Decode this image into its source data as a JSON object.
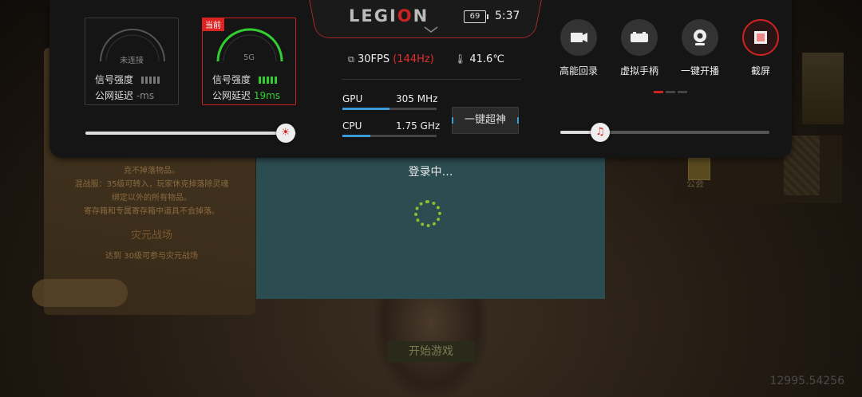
{
  "game": {
    "scroll_lines": [
      {
        "text": "克不掉落物品。",
        "highlight": false
      },
      {
        "text": "混战服：35级可转入，玩家休克掉落除灵魂",
        "highlight": false
      },
      {
        "text": "绑定以外的所有物品。",
        "highlight": false
      },
      {
        "text": "寄存箱和专属寄存箱中道具不会掉落。",
        "highlight": false
      }
    ],
    "scroll_title": "灾元战场",
    "scroll_footer": "达到 30级可参与灾元战场",
    "union_label": "公会",
    "start_button": "开始游戏",
    "coordinates": "12995.54256"
  },
  "login": {
    "status_text": "登录中…",
    "spinner_color": "#8fbf2f"
  },
  "panel": {
    "brand": {
      "pre": "LEGI",
      "accent": "O",
      "post": "N"
    },
    "battery": "69",
    "time": "5:37",
    "network": {
      "wifi": {
        "gauge_label": "未连接",
        "signal_label": "信号强度",
        "latency_label": "公网延迟",
        "latency_value": "-ms",
        "signal_bars": 5,
        "connected": false
      },
      "cellular": {
        "tag": "当前",
        "gauge_label": "5G",
        "signal_label": "信号强度",
        "latency_label": "公网延迟",
        "latency_value": "19ms",
        "signal_bars": 5,
        "connected": true
      }
    },
    "brightness_fraction": 0.95,
    "volume_fraction": 0.19,
    "fps": "30FPS",
    "refresh_rate": "(144Hz)",
    "temperature": "41.6℃",
    "gpu": {
      "label": "GPU",
      "value": "305 MHz",
      "fraction": 0.5
    },
    "cpu": {
      "label": "CPU",
      "value": "1.75 GHz",
      "fraction": 0.3
    },
    "boost_button": "一键超神",
    "tools": [
      {
        "label": "高能回录",
        "icon": "camera-record-icon",
        "active": false
      },
      {
        "label": "虚拟手柄",
        "icon": "gamepad-icon",
        "active": false
      },
      {
        "label": "一键开播",
        "icon": "webcam-icon",
        "active": false
      },
      {
        "label": "截屏",
        "icon": "screenshot-icon",
        "active": true
      }
    ],
    "accent_color": "#cc2222"
  }
}
